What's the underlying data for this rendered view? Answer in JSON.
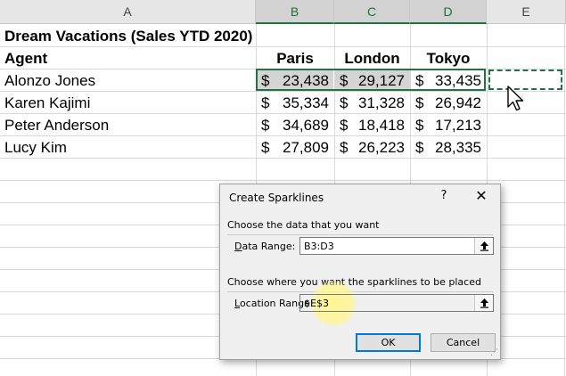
{
  "columns": [
    "A",
    "B",
    "C",
    "D",
    "E"
  ],
  "title": "Dream Vacations (Sales YTD 2020)",
  "headers": {
    "agent": "Agent",
    "paris": "Paris",
    "london": "London",
    "tokyo": "Tokyo"
  },
  "rows": [
    {
      "agent": "Alonzo Jones",
      "paris": "23,438",
      "london": "29,127",
      "tokyo": "33,435"
    },
    {
      "agent": "Karen Kajimi",
      "paris": "35,334",
      "london": "31,328",
      "tokyo": "26,942"
    },
    {
      "agent": "Peter Anderson",
      "paris": "34,689",
      "london": "18,418",
      "tokyo": "17,213"
    },
    {
      "agent": "Lucy Kim",
      "paris": "27,809",
      "london": "26,223",
      "tokyo": "28,335"
    }
  ],
  "currency": "$",
  "dialog": {
    "title": "Create Sparklines",
    "help": "?",
    "close": "✕",
    "data_group": "Choose the data that you want",
    "data_range_label_u": "D",
    "data_range_label_rest": "ata Range:",
    "data_range_value": "B3:D3",
    "location_group": "Choose where you want the sparklines to be placed",
    "location_label_u": "L",
    "location_label_rest": "ocation Range:",
    "location_value": "$E$3",
    "ok": "OK",
    "cancel": "Cancel"
  },
  "colors": {
    "excel_green": "#217346",
    "highlight": "#fff68c"
  },
  "icons": {
    "collapse": "collapse-dialog-icon",
    "cursor": "mouse-pointer-icon"
  }
}
